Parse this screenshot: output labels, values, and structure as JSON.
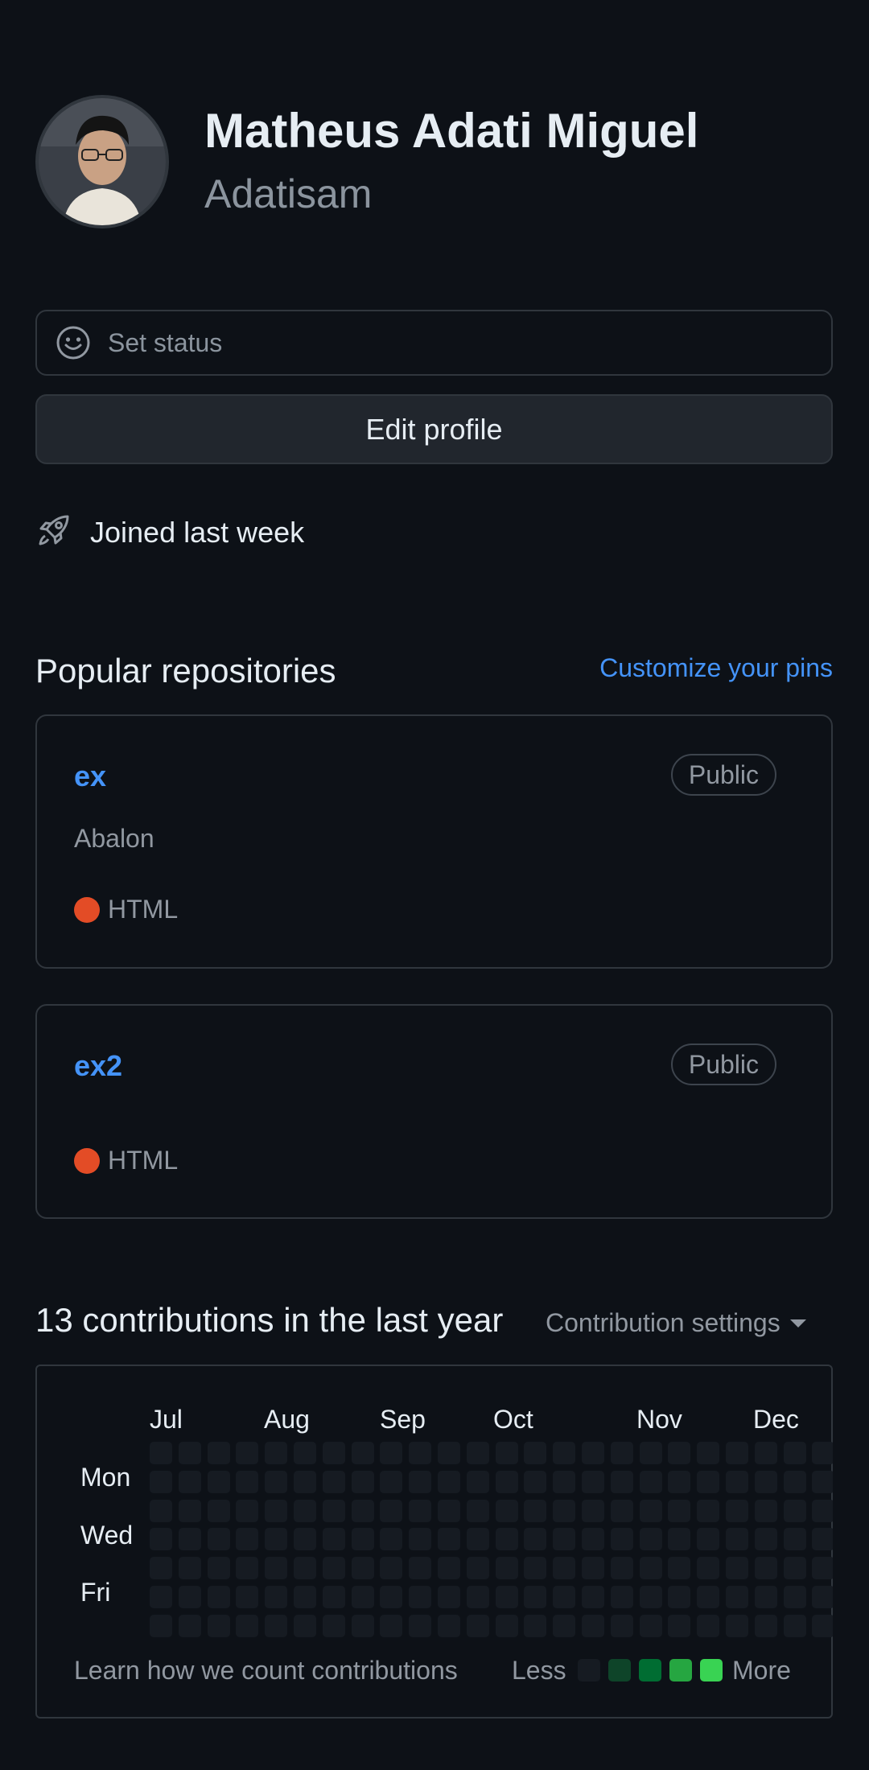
{
  "profile": {
    "full_name": "Matheus Adati Miguel",
    "username": "Adatisam",
    "avatar_icon": "user-avatar-photo"
  },
  "status": {
    "label": "Set status",
    "icon": "smiley-icon"
  },
  "edit_profile": {
    "label": "Edit profile"
  },
  "joined": {
    "label": "Joined last week",
    "icon": "rocket-icon"
  },
  "popular": {
    "title": "Popular repositories",
    "customize_label": "Customize your pins",
    "repos": [
      {
        "name": "ex",
        "visibility": "Public",
        "description": "Abalon",
        "language": "HTML",
        "language_color": "#e34c26"
      },
      {
        "name": "ex2",
        "visibility": "Public",
        "description": "",
        "language": "HTML",
        "language_color": "#e34c26"
      }
    ]
  },
  "contributions": {
    "title": "13 contributions in the last year",
    "settings_label": "Contribution settings",
    "months": [
      "Jul",
      "Aug",
      "Sep",
      "Oct",
      "Nov",
      "Dec"
    ],
    "days": [
      "Mon",
      "Wed",
      "Fri"
    ],
    "learn_label": "Learn how we count contributions",
    "less_label": "Less",
    "more_label": "More",
    "legend_colors": [
      "#161b22",
      "#0e4429",
      "#006d32",
      "#26a641",
      "#39d353"
    ],
    "empty_color": "#161b22"
  },
  "colors": {
    "background": "#0d1117",
    "link": "#4493f8",
    "border": "#30363d"
  }
}
